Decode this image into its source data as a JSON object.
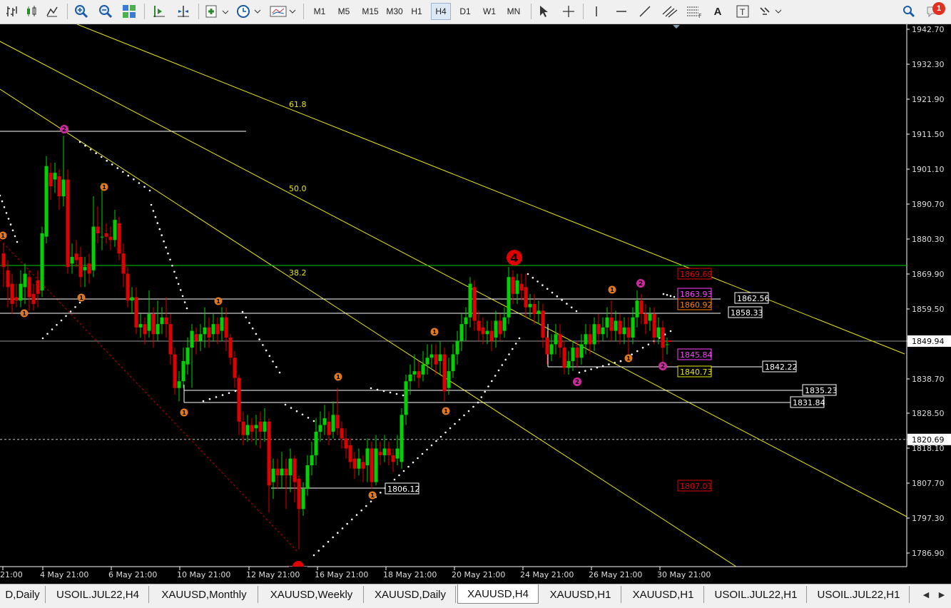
{
  "toolbar": {
    "timeframes": [
      "M1",
      "M5",
      "M15",
      "M30",
      "H1",
      "H4",
      "D1",
      "W1",
      "MN"
    ],
    "active_timeframe": "H4",
    "notification_count": "1"
  },
  "chart": {
    "symbol": "XAUUSD",
    "period": "H4",
    "current_price": "1849.94",
    "price_ticks": [
      "1942.70",
      "1932.30",
      "1921.90",
      "1911.50",
      "1901.10",
      "1890.70",
      "1880.30",
      "1869.90",
      "1859.50",
      "1849.94",
      "1838.70",
      "1828.50",
      "1820.69",
      "1818.10",
      "1807.70",
      "1797.30",
      "1786.90"
    ],
    "time_ticks": [
      "21:00",
      "4 May 21:00",
      "6 May 21:00",
      "10 May 21:00",
      "12 May 21:00",
      "16 May 21:00",
      "18 May 21:00",
      "20 May 21:00",
      "24 May 21:00",
      "26 May 21:00",
      "30 May 21:00"
    ],
    "fib_levels": [
      "61.8",
      "50.0",
      "38.2"
    ],
    "price_labels": {
      "l1869": "1869.69",
      "l1863": "1863.93",
      "l1862": "1862.56",
      "l1860": "1860.92",
      "l1858": "1858.33",
      "l1845": "1845.84",
      "l1842": "1842.22",
      "l1840": "1840.73",
      "l1835": "1835.23",
      "l1831": "1831.84",
      "l1807": "1807.01",
      "l1806": "1806.12"
    },
    "wave_labels": {
      "big4": "4",
      "w2a": "2",
      "w2b": "2",
      "w2c": "2",
      "w2d": "2",
      "w1": "1"
    },
    "colors": {
      "background": "#000000",
      "bull": "#00d200",
      "bear": "#e00000",
      "fib": "#e8e800",
      "grid": "#ffffff"
    }
  },
  "tabs": [
    "D,Daily",
    "USOIL.JUL22,H4",
    "XAUUSD,Monthly",
    "XAUUSD,Weekly",
    "XAUUSD,Daily",
    "XAUUSD,H4",
    "XAUUSD,H1",
    "XAUUSD,H1",
    "USOIL.JUL22,H1",
    "USOIL.JUL22,H1"
  ],
  "active_tab": "XAUUSD,H4"
}
